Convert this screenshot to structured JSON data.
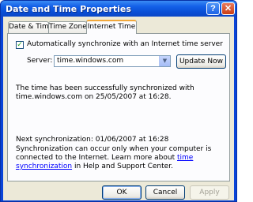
{
  "window": {
    "title": "Date and Time Properties",
    "help_label": "?",
    "close_label": "✕"
  },
  "tabs": [
    {
      "label": "Date & Time",
      "active": false
    },
    {
      "label": "Time Zone",
      "active": false
    },
    {
      "label": "Internet Time",
      "active": true
    }
  ],
  "internet_time": {
    "auto_sync_label": "Automatically synchronize with an Internet time server",
    "auto_sync_checked": true,
    "checkmark": "✓",
    "server_label": "Server:",
    "server_value": "time.windows.com",
    "update_now_label": "Update Now",
    "sync_status_text": "The time has been successfully synchronized with time.windows.com on 25/05/2007 at 16:28.",
    "next_sync_text": "Next synchronization: 01/06/2007 at 16:28",
    "info_text_before": "Synchronization can occur only when your computer is connected to the Internet.  Learn more about ",
    "info_link": "time synchronization",
    "info_text_after": " in Help and Support Center."
  },
  "footer": {
    "ok_label": "OK",
    "cancel_label": "Cancel",
    "apply_label": "Apply"
  },
  "colors": {
    "title_bar": "#0a4fd6",
    "dialog_face": "#ece9d8",
    "active_tab_highlight": "#f1a73a",
    "link": "#0000ff"
  }
}
